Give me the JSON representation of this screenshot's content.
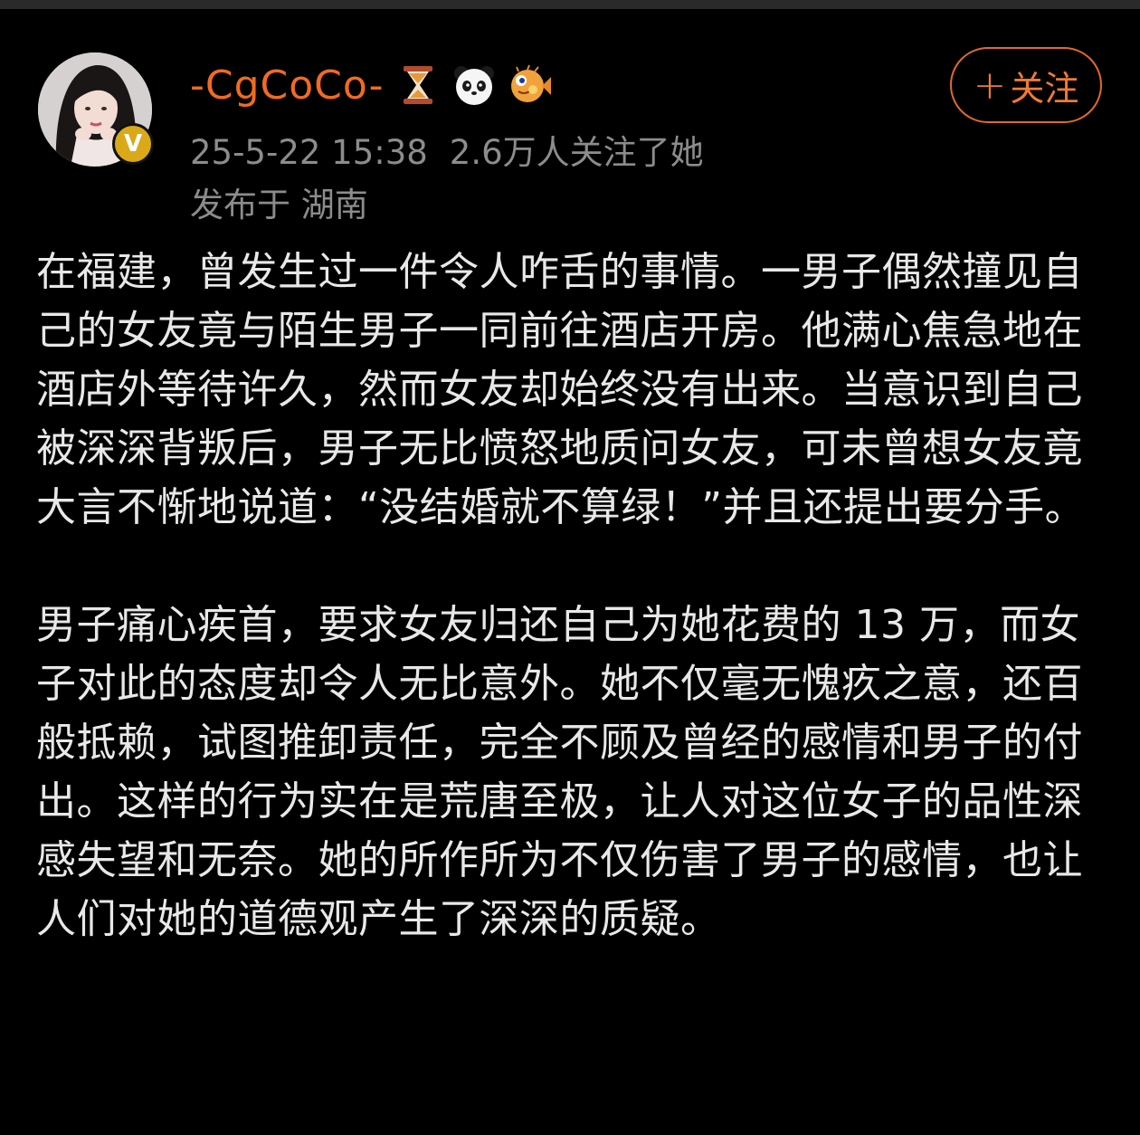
{
  "post": {
    "author": {
      "name": "-CgCoCo-",
      "verified": true,
      "badges": [
        "hourglass-icon",
        "panda-icon",
        "pufferfish-icon"
      ]
    },
    "timestamp": "25-5-22 15:38",
    "followers": "2.6万人关注了她",
    "location": "发布于 湖南",
    "follow_button": {
      "plus": "+",
      "label": "关注"
    },
    "paragraphs": [
      "在福建，曾发生过一件令人咋舌的事情。一男子偶然撞见自己的女友竟与陌生男子一同前往酒店开房。他满心焦急地在酒店外等待许久，然而女友却始终没有出来。当意识到自己被深深背叛后，男子无比愤怒地质问女友，可未曾想女友竟大言不惭地说道：“没结婚就不算绿！”并且还提出要分手。",
      "男子痛心疾首，要求女友归还自己为她花费的 13 万，而女子对此的态度却令人无比意外。她不仅毫无愧疚之意，还百般抵赖，试图推卸责任，完全不顾及曾经的感情和男子的付出。这样的行为实在是荒唐至极，让人对这位女子的品性深感失望和无奈。她的所作所为不仅伤害了男子的感情，也让人们对她的道德观产生了深深的质疑。"
    ]
  },
  "colors": {
    "background": "#000000",
    "username": "#f06b22",
    "meta": "#8c8c8c",
    "body_text": "#e8e8e8",
    "follow_accent": "#e06a2a",
    "verified_badge": "#d9a91a"
  }
}
